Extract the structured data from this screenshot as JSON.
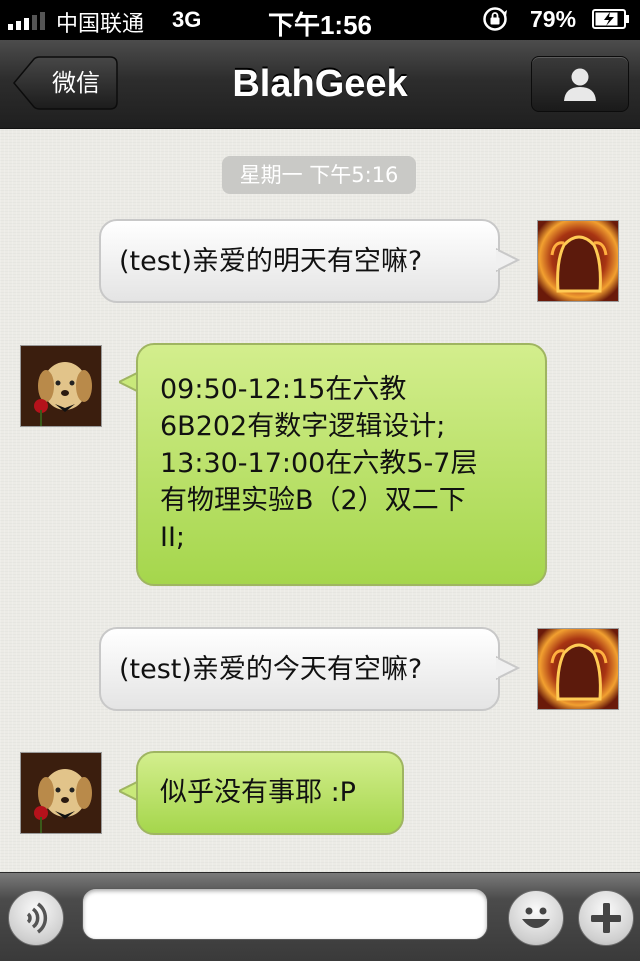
{
  "status": {
    "carrier": "中国联通",
    "network": "3G",
    "time": "下午1:56",
    "battery": "79%"
  },
  "nav": {
    "back_label": "微信",
    "title": "BlahGeek"
  },
  "chat": {
    "timestamp": "星期一 下午5:16",
    "messages": [
      {
        "side": "right",
        "lines": [
          "(test)亲爱的明天有空嘛?"
        ]
      },
      {
        "side": "left",
        "lines": [
          "09:50-12:15在六教",
          "6B202有数字逻辑设计;",
          "13:30-17:00在六教5-7层",
          "有物理实验B（2）双二下",
          "II;"
        ]
      },
      {
        "side": "right",
        "lines": [
          "(test)亲爱的今天有空嘛?"
        ]
      },
      {
        "side": "left",
        "lines": [
          "似乎没有事耶 :P"
        ]
      }
    ]
  },
  "input": {
    "placeholder": ""
  },
  "icons": {
    "voice": "voice-icon",
    "emoji": "emoji-icon",
    "more": "plus-icon",
    "profile": "person-icon",
    "lock": "rotation-lock-icon",
    "battery": "battery-icon"
  },
  "colors": {
    "left_bubble": "#a5d64c",
    "right_bubble": "#ffffff",
    "nav_bar": "#2d2d2d"
  }
}
